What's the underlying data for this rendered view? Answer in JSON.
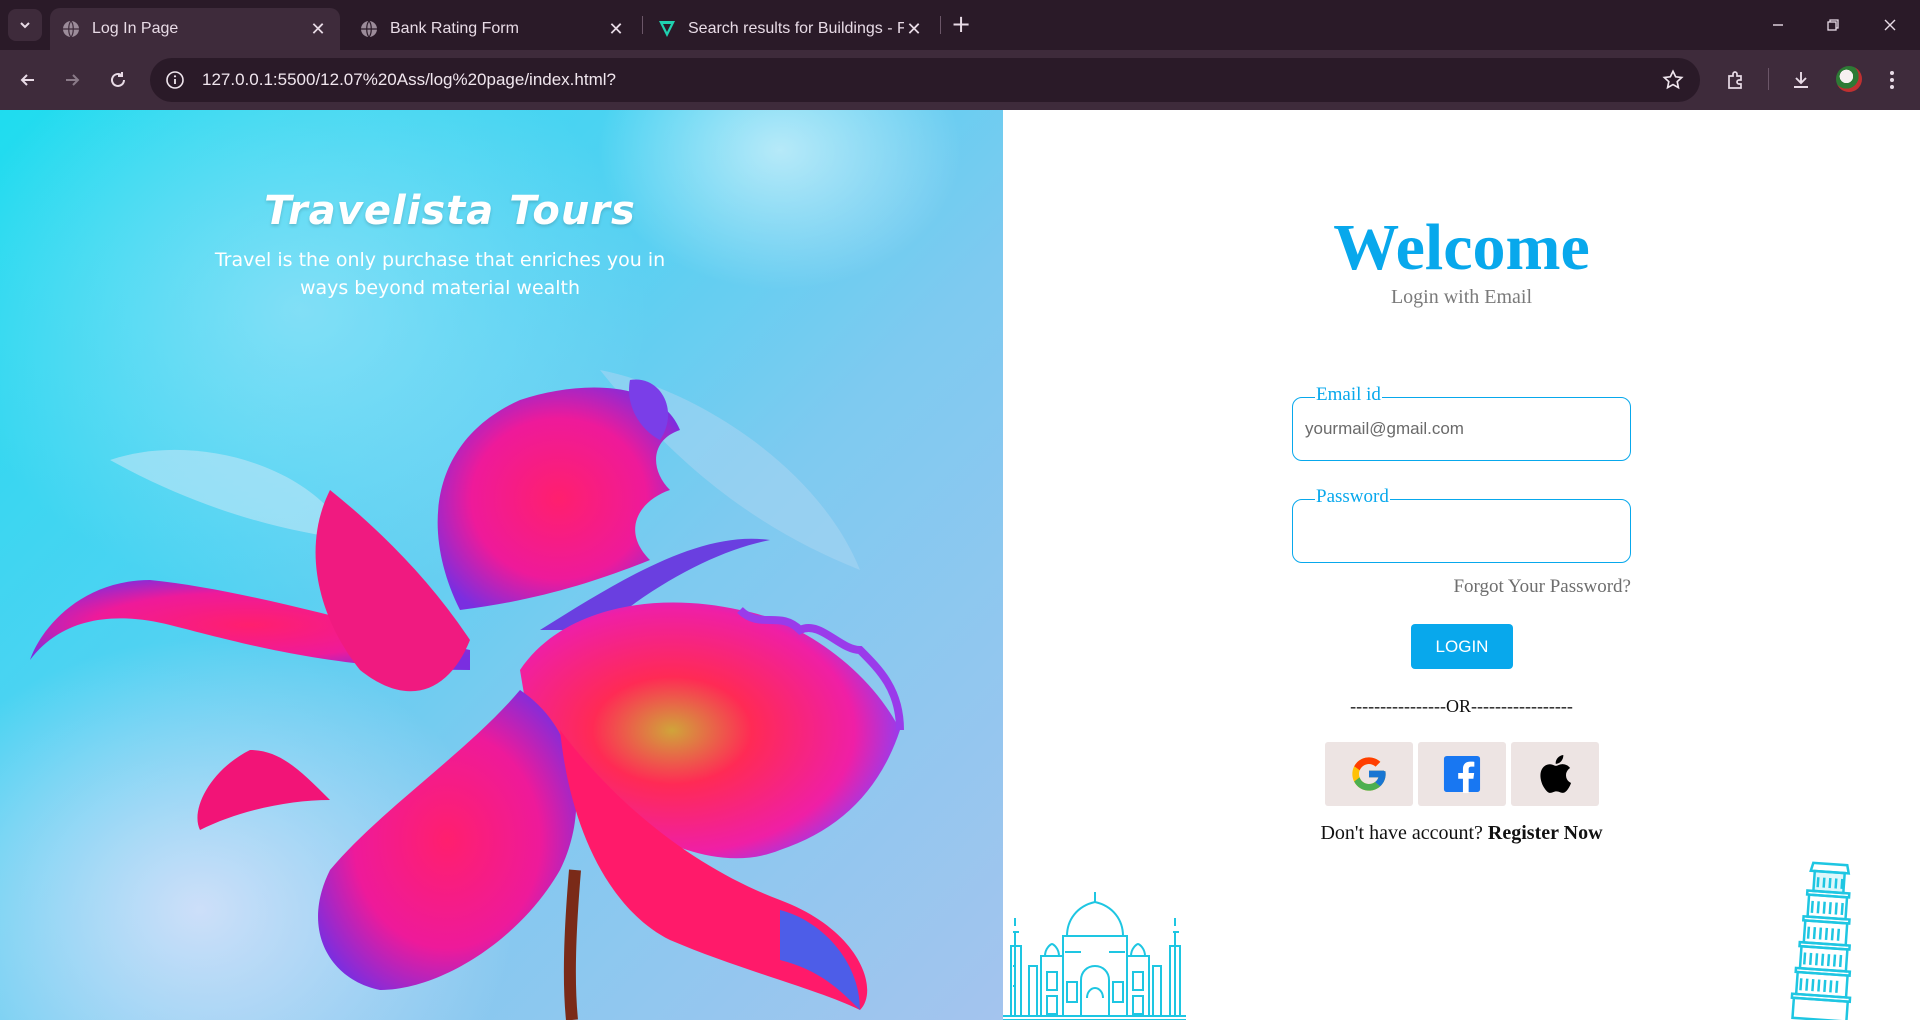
{
  "browser": {
    "tabs": [
      {
        "title": "Log In Page",
        "active": true,
        "favicon": "globe-icon"
      },
      {
        "title": "Bank Rating Form",
        "active": false,
        "favicon": "globe-icon"
      },
      {
        "title": "Search results for Buildings - Fl",
        "active": false,
        "favicon": "flaticon-icon"
      }
    ],
    "url": "127.0.0.1:5500/12.07%20Ass/log%20page/index.html?",
    "accent": "#3e2b3b"
  },
  "hero": {
    "title": "Travelista Tours",
    "tagline": "Travel is the only purchase that enriches you in ways beyond material wealth"
  },
  "login": {
    "heading": "Welcome",
    "subtitle": "Login with Email",
    "email_label": "Email id",
    "email_placeholder": "yourmail@gmail.com",
    "password_label": "Password",
    "forgot": "Forgot Your Password?",
    "login_button": "LOGIN",
    "divider": "----------------OR-----------------",
    "social": [
      "google-icon",
      "facebook-icon",
      "apple-icon"
    ],
    "register_prompt": "Don't have account?",
    "register_link": "Register Now",
    "accent_color": "#08a8ec"
  },
  "decor": [
    "taj-mahal-illustration",
    "leaning-tower-illustration"
  ]
}
